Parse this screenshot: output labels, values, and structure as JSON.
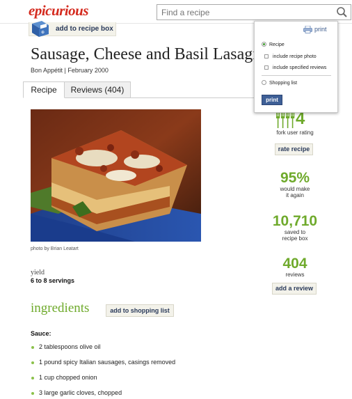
{
  "header": {
    "logo": "epicurious",
    "search_placeholder": "Find a recipe"
  },
  "recipe_box": {
    "label": "add to recipe box"
  },
  "recipe": {
    "title": "Sausage, Cheese and Basil Lasagna",
    "meta": "Bon Appétit | February 2000",
    "photo_credit": "photo by Brian Leatart",
    "yield_label": "yield",
    "yield_value": "6 to 8 servings"
  },
  "tabs": [
    {
      "label": "Recipe",
      "active": true
    },
    {
      "label": "Reviews (404)",
      "active": false
    }
  ],
  "print_panel": {
    "print_link": "print",
    "option_recipe": "Recipe",
    "option_photo": "include recipe photo",
    "option_reviews": "include specified reviews",
    "option_shopping": "Shopping list",
    "print_button": "print"
  },
  "ratings": {
    "fork_rating": "4",
    "fork_label": "fork user rating",
    "rate_button": "rate recipe",
    "make_again_pct": "95%",
    "make_again_label_1": "would make",
    "make_again_label_2": "it again",
    "saved_count": "10,710",
    "saved_label_1": "saved to",
    "saved_label_2": "recipe box",
    "reviews_count": "404",
    "reviews_label": "reviews",
    "review_button": "add a review"
  },
  "ingredients": {
    "title": "ingredients",
    "shopping_button": "add to shopping list",
    "section": "Sauce:",
    "items": [
      "2 tablespoons olive oil",
      "1 pound spicy Italian sausages, casings removed",
      "1 cup chopped onion",
      "3 large garlic cloves, chopped"
    ]
  },
  "colors": {
    "brand_red": "#d42a1e",
    "accent_green": "#6faa2c",
    "button_blue": "#3e5f96"
  }
}
